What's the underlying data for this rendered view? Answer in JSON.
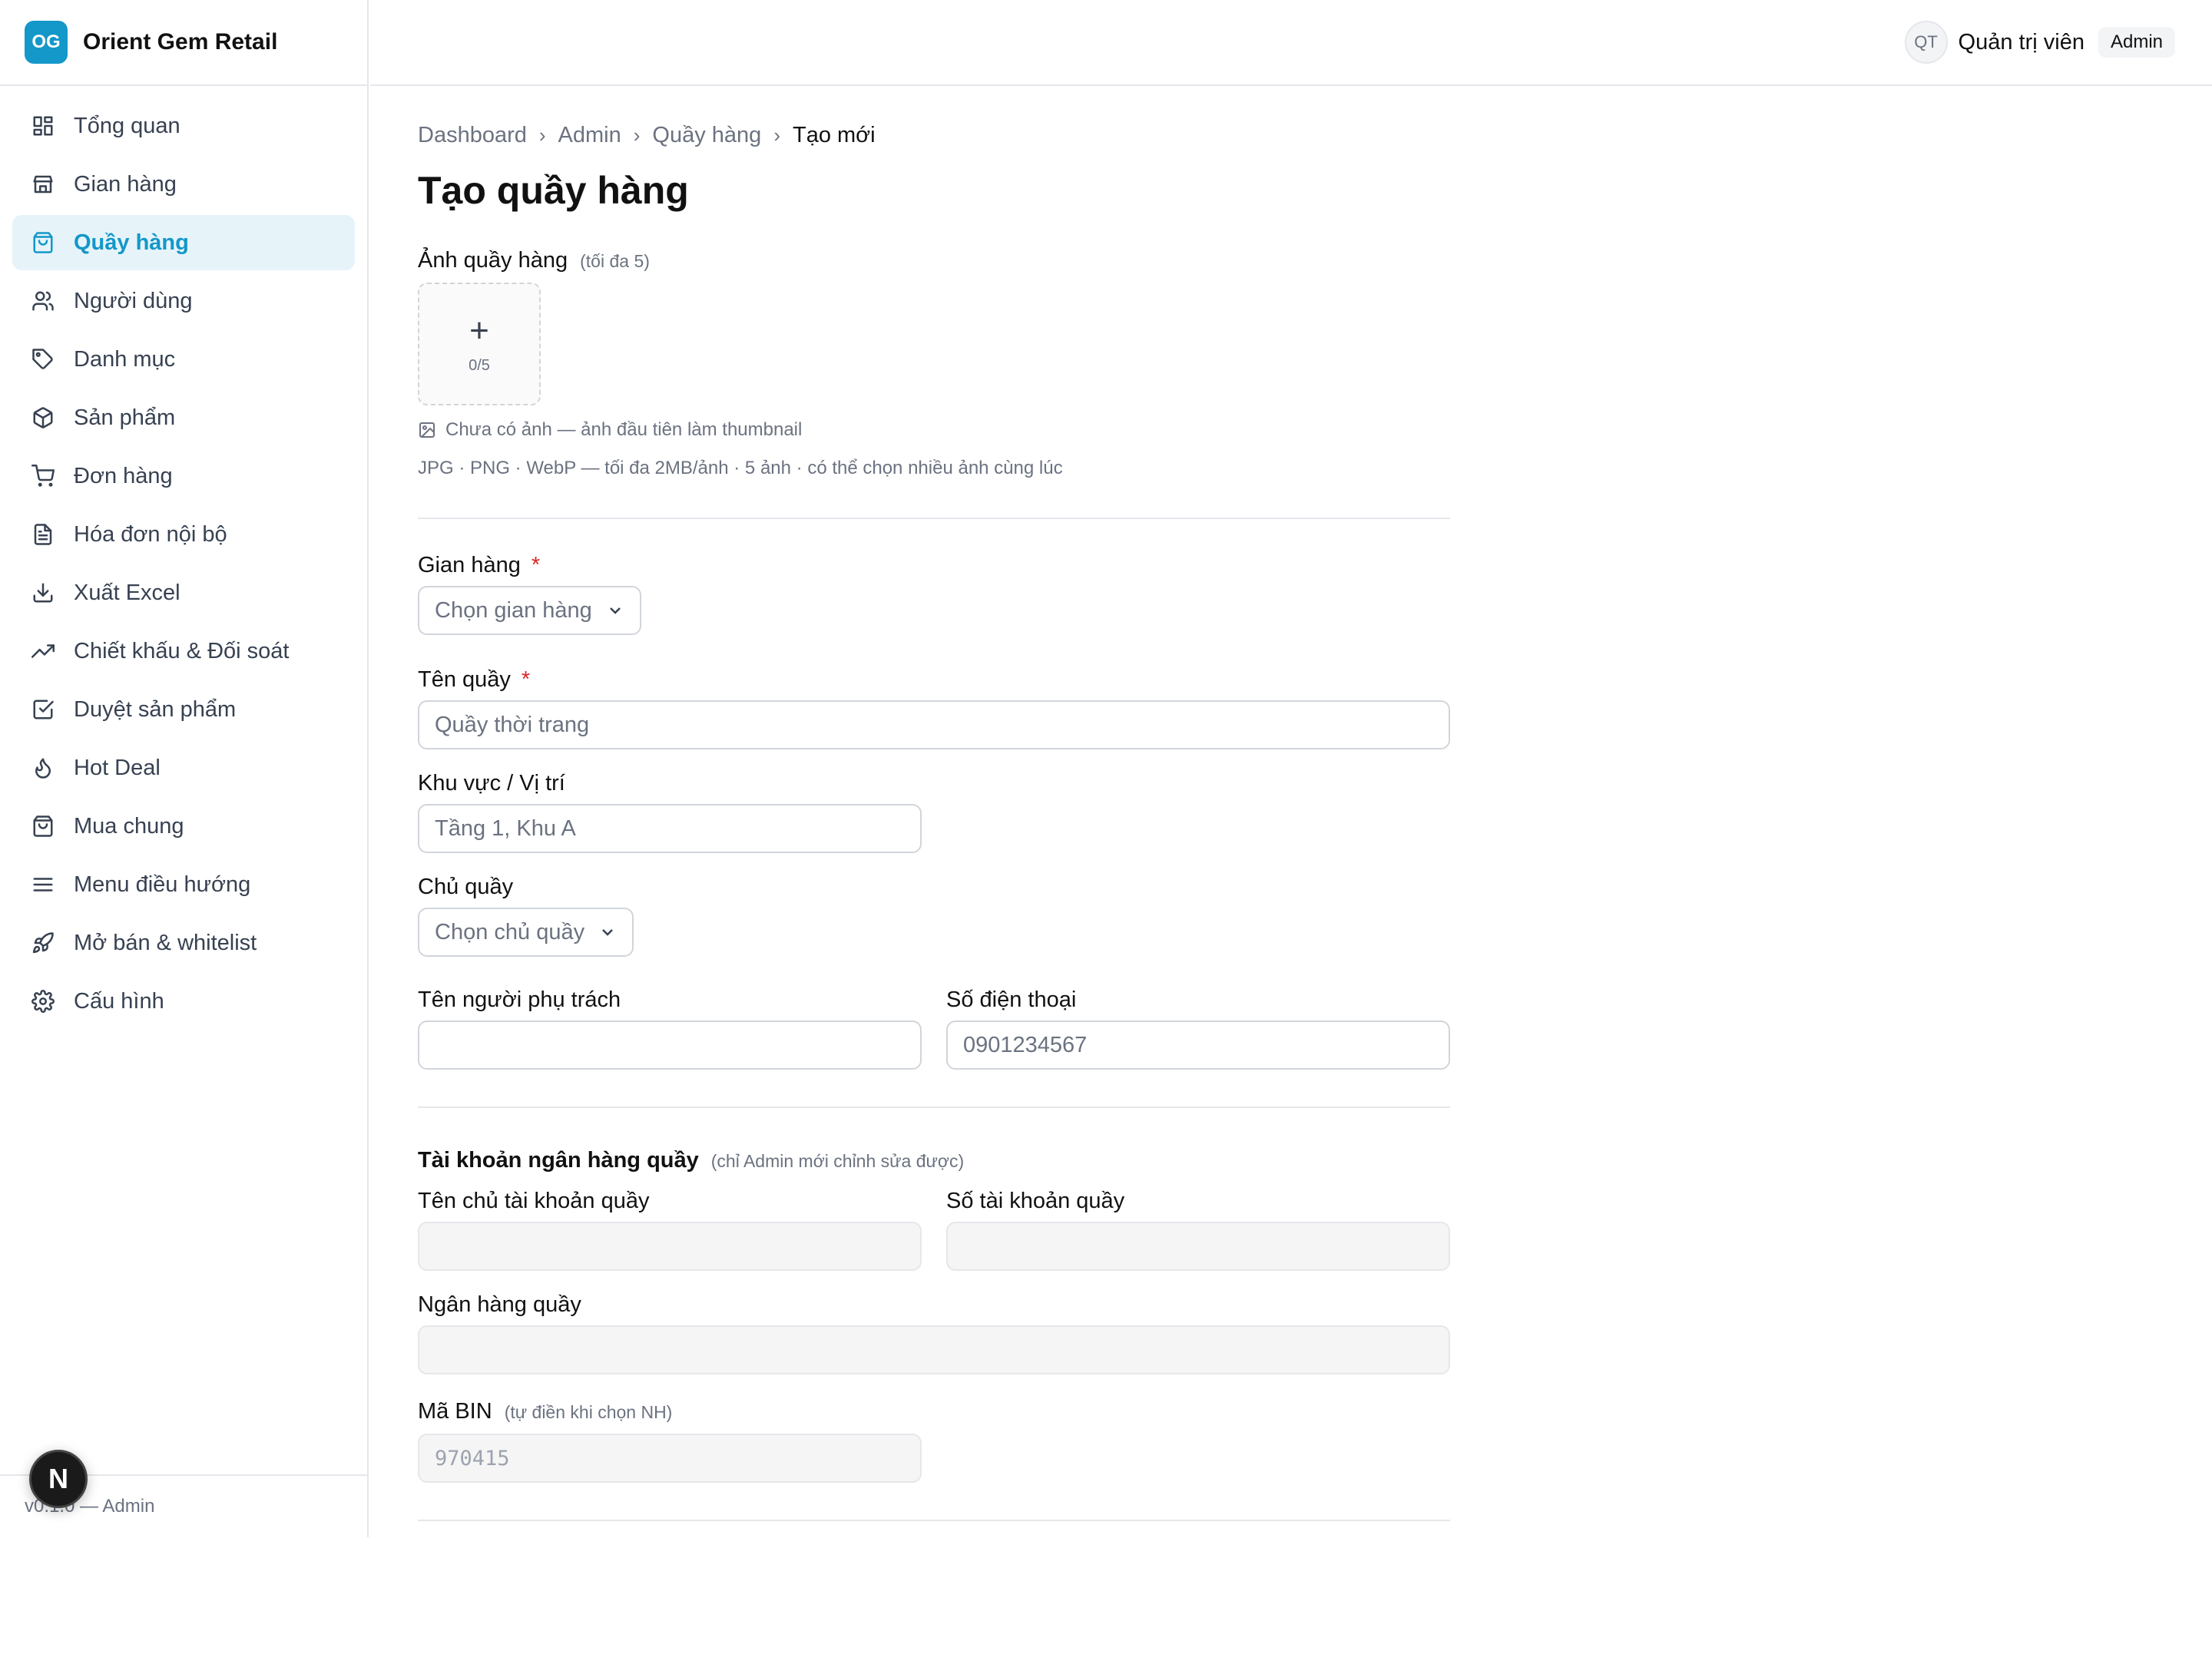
{
  "brand": {
    "logo": "OG",
    "name": "Orient Gem Retail",
    "color": "#1497c9"
  },
  "sidebar": {
    "items": [
      {
        "label": "Tổng quan",
        "icon": "dashboard-icon",
        "active": false
      },
      {
        "label": "Gian hàng",
        "icon": "store-icon",
        "active": false
      },
      {
        "label": "Quầy hàng",
        "icon": "shopping-bag-icon",
        "active": true
      },
      {
        "label": "Người dùng",
        "icon": "users-icon",
        "active": false
      },
      {
        "label": "Danh mục",
        "icon": "tag-icon",
        "active": false
      },
      {
        "label": "Sản phẩm",
        "icon": "package-icon",
        "active": false
      },
      {
        "label": "Đơn hàng",
        "icon": "cart-icon",
        "active": false
      },
      {
        "label": "Hóa đơn nội bộ",
        "icon": "file-text-icon",
        "active": false
      },
      {
        "label": "Xuất Excel",
        "icon": "download-icon",
        "active": false
      },
      {
        "label": "Chiết khấu & Đối soát",
        "icon": "trending-up-icon",
        "active": false
      },
      {
        "label": "Duyệt sản phẩm",
        "icon": "check-square-icon",
        "active": false
      },
      {
        "label": "Hot Deal",
        "icon": "flame-icon",
        "active": false
      },
      {
        "label": "Mua chung",
        "icon": "shopping-bag-icon",
        "active": false
      },
      {
        "label": "Menu điều hướng",
        "icon": "menu-icon",
        "active": false
      },
      {
        "label": "Mở bán & whitelist",
        "icon": "rocket-icon",
        "active": false
      },
      {
        "label": "Cấu hình",
        "icon": "gear-icon",
        "active": false
      }
    ],
    "footer": "v0.1.0 — Admin",
    "next_badge": "N"
  },
  "header": {
    "avatar": "QT",
    "user_name": "Quản trị viên",
    "role": "Admin"
  },
  "breadcrumb": [
    "Dashboard",
    "Admin",
    "Quầy hàng",
    "Tạo mới"
  ],
  "page_title": "Tạo quầy hàng",
  "images": {
    "label": "Ảnh quầy hàng",
    "hint": "(tối đa 5)",
    "count": "0/5",
    "note": "Chưa có ảnh — ảnh đầu tiên làm thumbnail",
    "formats": "JPG · PNG · WebP — tối đa 2MB/ảnh · 5 ảnh · có thể chọn nhiều ảnh cùng lúc"
  },
  "form": {
    "store": {
      "label": "Gian hàng",
      "required": "*",
      "placeholder": "Chọn gian hàng"
    },
    "counter_name": {
      "label": "Tên quầy",
      "required": "*",
      "placeholder": "Quầy thời trang"
    },
    "location": {
      "label": "Khu vực / Vị trí",
      "placeholder": "Tầng 1, Khu A"
    },
    "owner": {
      "label": "Chủ quầy",
      "placeholder": "Chọn chủ quầy"
    },
    "manager_name": {
      "label": "Tên người phụ trách",
      "placeholder": ""
    },
    "phone": {
      "label": "Số điện thoại",
      "placeholder": "0901234567"
    }
  },
  "bank": {
    "title": "Tài khoản ngân hàng quầy",
    "hint": "(chỉ Admin mới chỉnh sửa được)",
    "holder": {
      "label": "Tên chủ tài khoản quầy",
      "value": ""
    },
    "account_no": {
      "label": "Số tài khoản quầy",
      "value": ""
    },
    "bank_name": {
      "label": "Ngân hàng quầy",
      "value": ""
    },
    "bin": {
      "label": "Mã BIN",
      "hint": "(tự điền khi chọn NH)",
      "placeholder": "970415"
    }
  }
}
